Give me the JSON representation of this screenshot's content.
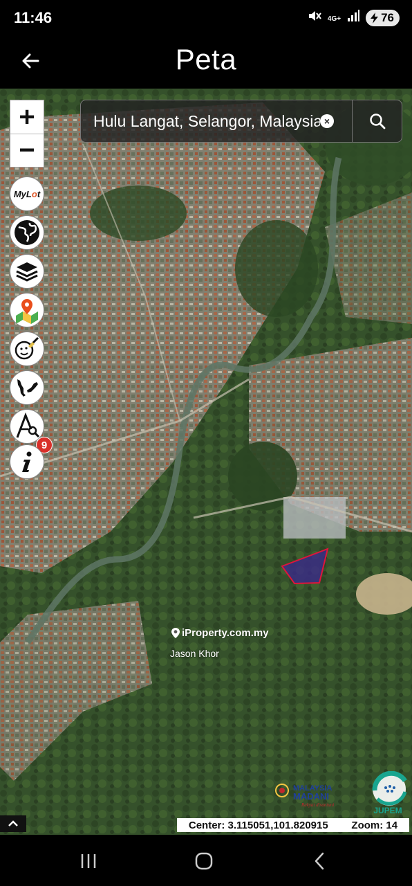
{
  "status_bar": {
    "time": "11:46",
    "network": "4G+",
    "battery": "76"
  },
  "app_bar": {
    "title": "Peta"
  },
  "search": {
    "value": "Hulu Langat, Selangor, Malaysia"
  },
  "zoom": {
    "plus_label": "+",
    "minus_label": "−"
  },
  "tools": {
    "mylot_label_main": "My",
    "mylot_label_accent": "L",
    "mylot_label_rest": "t",
    "notification_count": "9"
  },
  "watermark": {
    "brand": "iProperty.com.my",
    "agent": "Jason Khor"
  },
  "logos": {
    "madani_line1": "MALAYSIA",
    "madani_line2": "MADANI",
    "madani_tagline": "Rakyat disantuni",
    "jupem": "JUPEM"
  },
  "map_info": {
    "center": "Center: 3.115051,101.820915",
    "zoom": "Zoom: 14"
  },
  "colors": {
    "parcel_fill": "#3b2a8a",
    "parcel_stroke": "#e0143c",
    "badge": "#d9302a"
  }
}
